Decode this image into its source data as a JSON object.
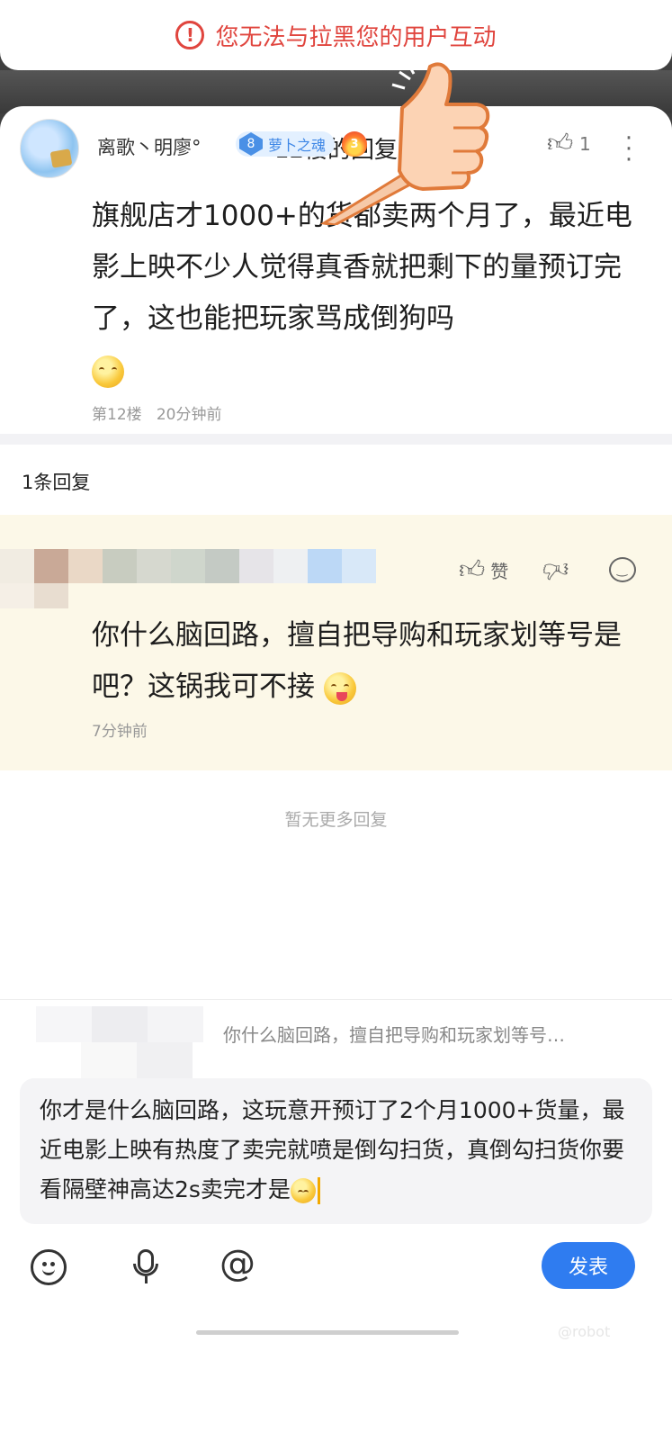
{
  "toast": {
    "icon": "alert-circle-icon",
    "text": "您无法与拉黑您的用户互动",
    "color": "#e0453e"
  },
  "header": {
    "title": "12楼的回复"
  },
  "post": {
    "username": "离歌丶明廖°",
    "level": "8",
    "level_title": "萝卜之魂",
    "fire_badge": "3",
    "like_count": "1",
    "text": "旗舰店才1000+的货都卖两个月了，最近电影上映不少人觉得真香就把剩下的量预订完了，这也能把玩家骂成倒狗吗",
    "floor": "第12楼",
    "time": "20分钟前"
  },
  "replies_header": {
    "count_label": "1条回复"
  },
  "reply": {
    "like_label": "赞",
    "text": "你什么脑回路，擅自把导购和玩家划等号是吧？这锅我可不接",
    "time": "7分钟前"
  },
  "no_more": "暂无更多回复",
  "compose": {
    "quote": "你什么脑回路，擅自把导购和玩家划等号…",
    "text": "你才是什么脑回路，这玩意开预订了2个月1000+货量，最近电影上映有热度了卖完就喷是倒勾扫货，真倒勾扫货你要看隔壁神高达2s卖完才是",
    "send_label": "发表"
  },
  "watermark": "@robot",
  "colors": {
    "accent": "#2f7cf0",
    "reply_bg": "#fcf8e8",
    "level_badge": "#4a90e6"
  }
}
